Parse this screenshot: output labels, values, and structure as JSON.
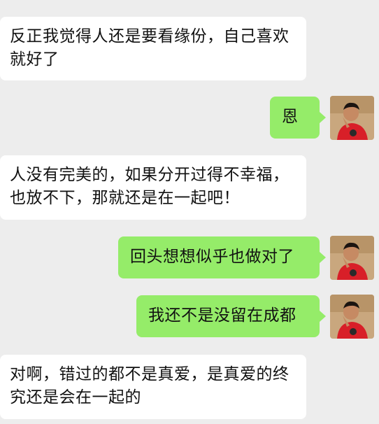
{
  "colors": {
    "background": "#ededed",
    "incoming_bubble": "#ffffff",
    "outgoing_bubble": "#95ec69"
  },
  "messages": [
    {
      "side": "in",
      "text": "反正我觉得人还是要看缘份，自己喜欢就好了"
    },
    {
      "side": "out",
      "text": "恩",
      "avatar": "user-avatar-icon"
    },
    {
      "side": "in",
      "text": "人没有完美的，如果分开过得不幸福，也放不下，那就还是在一起吧！"
    },
    {
      "side": "out",
      "text": "回头想想似乎也做对了",
      "avatar": "user-avatar-icon"
    },
    {
      "side": "out",
      "text": "我还不是没留在成都",
      "avatar": "user-avatar-icon"
    },
    {
      "side": "in",
      "text": "对啊，错过的都不是真爱，是真爱的终究还是会在一起的"
    }
  ]
}
